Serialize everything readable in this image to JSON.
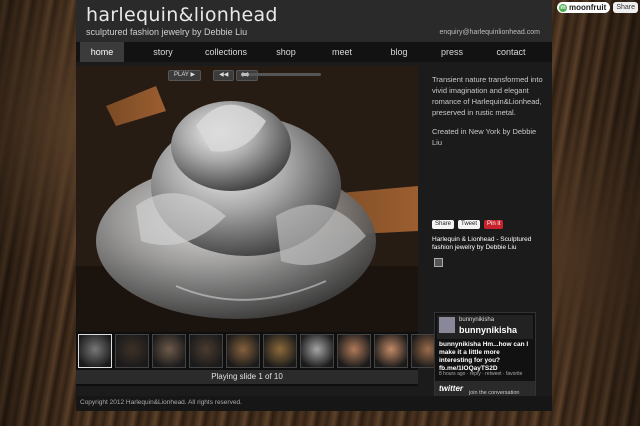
{
  "badges": {
    "moonfruit": "moonfruit",
    "share": "Share"
  },
  "header": {
    "logo": "harlequin&lionhead",
    "tagline": "sculptured fashion jewelry by Debbie Liu",
    "email": "enquiry@harlequinlionhead.com"
  },
  "nav": {
    "items": [
      {
        "label": "home"
      },
      {
        "label": "story"
      },
      {
        "label": "collections"
      },
      {
        "label": "shop"
      },
      {
        "label": "meet"
      },
      {
        "label": "blog"
      },
      {
        "label": "press"
      },
      {
        "label": "contact"
      }
    ],
    "active_index": 0
  },
  "slideshow": {
    "play_label": "PLAY ▶",
    "prev_label": "◀◀",
    "next_label": "▶▶",
    "progress": 0.1,
    "caption": "Playing slide 1 of 10",
    "thumb_count": 10,
    "selected_thumb": 0
  },
  "sidebar": {
    "intro": "Transient nature transformed into vivid imagination and elegant romance of Harlequin&Lionhead, preserved in rustic metal.",
    "created": "Created in New York by Debbie Liu",
    "social": {
      "share": "Share",
      "tweet": "Tweet",
      "pin": "Pin it"
    },
    "title": "Harlequin & Lionhead - Sculptured fashion jewelry by Debbie Liu"
  },
  "twitter": {
    "handle_small": "bunnynikisha",
    "handle": "bunnynikisha",
    "tweet": "bunnynikisha Hm...how can I make it a little more interesting for you? fb.me/1IOQayTS2D",
    "meta": "8 hours ago · reply · retweet · favorite",
    "logo": "twitter",
    "join": "join the conversation"
  },
  "footer": {
    "copyright": "Copyright 2012 Harlequin&Lionhead. All rights reserved."
  }
}
